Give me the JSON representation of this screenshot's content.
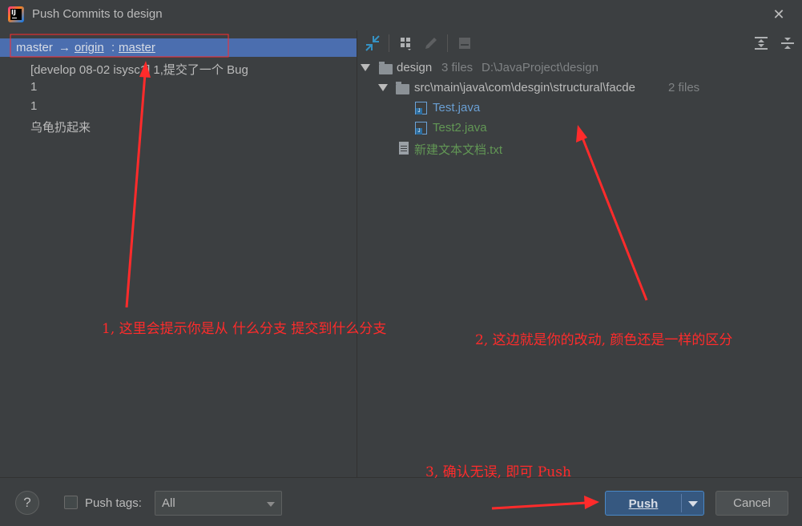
{
  "window": {
    "title": "Push Commits to design"
  },
  "left": {
    "branch": {
      "source": "master",
      "arrow": "→",
      "remote": "origin",
      "sep": ":",
      "target": "master"
    },
    "commits": [
      "[develop 08-02 isysc1] 1,提交了一个 Bug",
      "1",
      "1",
      "乌龟扔起来"
    ]
  },
  "right": {
    "tree": {
      "root": {
        "name": "design",
        "count": "3 files",
        "path": "D:\\JavaProject\\design"
      },
      "folder": {
        "name": "src\\main\\java\\com\\desgin\\structural\\facde",
        "count": "2 files"
      },
      "files": [
        {
          "name": "Test.java",
          "color": "#6a9fd3"
        },
        {
          "name": "Test2.java",
          "color": "#629755"
        }
      ],
      "txt": {
        "name": "新建文本文档.txt",
        "color": "#629755"
      }
    }
  },
  "annotations": {
    "note1": "1, 这里会提示你是从 什么分支 提交到什么分支",
    "note2": "2, 这边就是你的改动, 颜色还是一样的区分",
    "note3": "3, 确认无误, 即可 Push"
  },
  "footer": {
    "help": "?",
    "push_tags_label": "Push tags:",
    "tags_value": "All",
    "push_label": "Push",
    "cancel_label": "Cancel"
  },
  "colors": {
    "background": "#3c3f41",
    "selection": "#4b6eaf",
    "annotation_red": "#ff2b2b",
    "push_button": "#365880"
  }
}
